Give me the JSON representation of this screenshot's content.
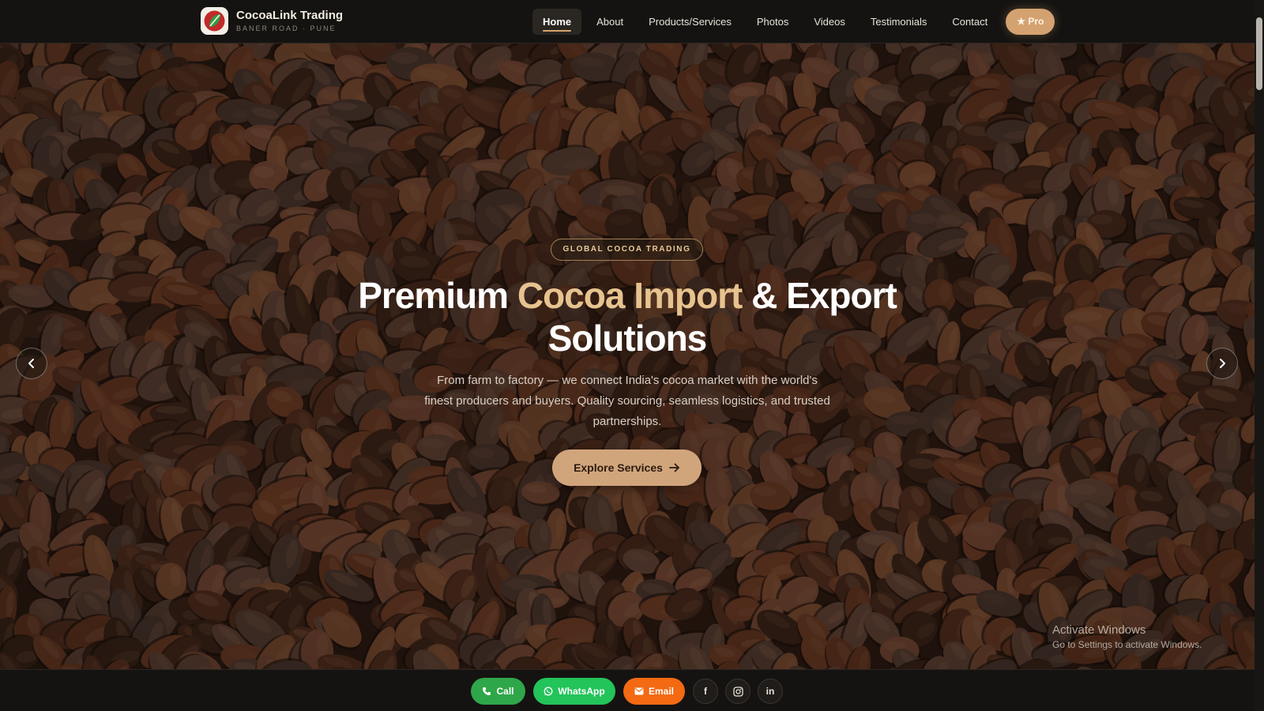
{
  "brand": {
    "name": "CocoaLink Trading",
    "subtitle": "BANER ROAD · PUNE",
    "logo_icon": "cocoa-pod-logo"
  },
  "nav": {
    "items": [
      {
        "label": "Home",
        "active": true
      },
      {
        "label": "About",
        "active": false
      },
      {
        "label": "Products/Services",
        "active": false
      },
      {
        "label": "Photos",
        "active": false
      },
      {
        "label": "Videos",
        "active": false
      },
      {
        "label": "Testimonials",
        "active": false
      },
      {
        "label": "Contact",
        "active": false
      }
    ],
    "pro_label": "Pro",
    "pro_icon": "star-icon"
  },
  "hero": {
    "tag": "GLOBAL COCOA TRADING",
    "title_part1": "Premium ",
    "title_accent": "Cocoa Import",
    "title_part2": " & Export Solutions",
    "subtitle": "From farm to factory — we connect India's cocoa market with the world's finest producers and buyers. Quality sourcing, seamless logistics, and trusted partnerships.",
    "cta_label": "Explore Services",
    "prev_icon": "chevron-left-icon",
    "next_icon": "chevron-right-icon",
    "background": "cocoa beans"
  },
  "contact_bar": {
    "call_label": "Call",
    "whatsapp_label": "WhatsApp",
    "email_label": "Email",
    "socials": [
      "facebook-icon",
      "instagram-icon",
      "linkedin-icon"
    ]
  },
  "system_overlay": {
    "activate_title": "Activate Windows",
    "activate_sub": "Go to Settings to activate Windows."
  },
  "colors": {
    "accent": "#d4a270",
    "title_accent": "#e6c38f",
    "call": "#2fa64a",
    "whatsapp": "#23c45a",
    "email": "#f36a12",
    "header_bg": "#141311"
  }
}
